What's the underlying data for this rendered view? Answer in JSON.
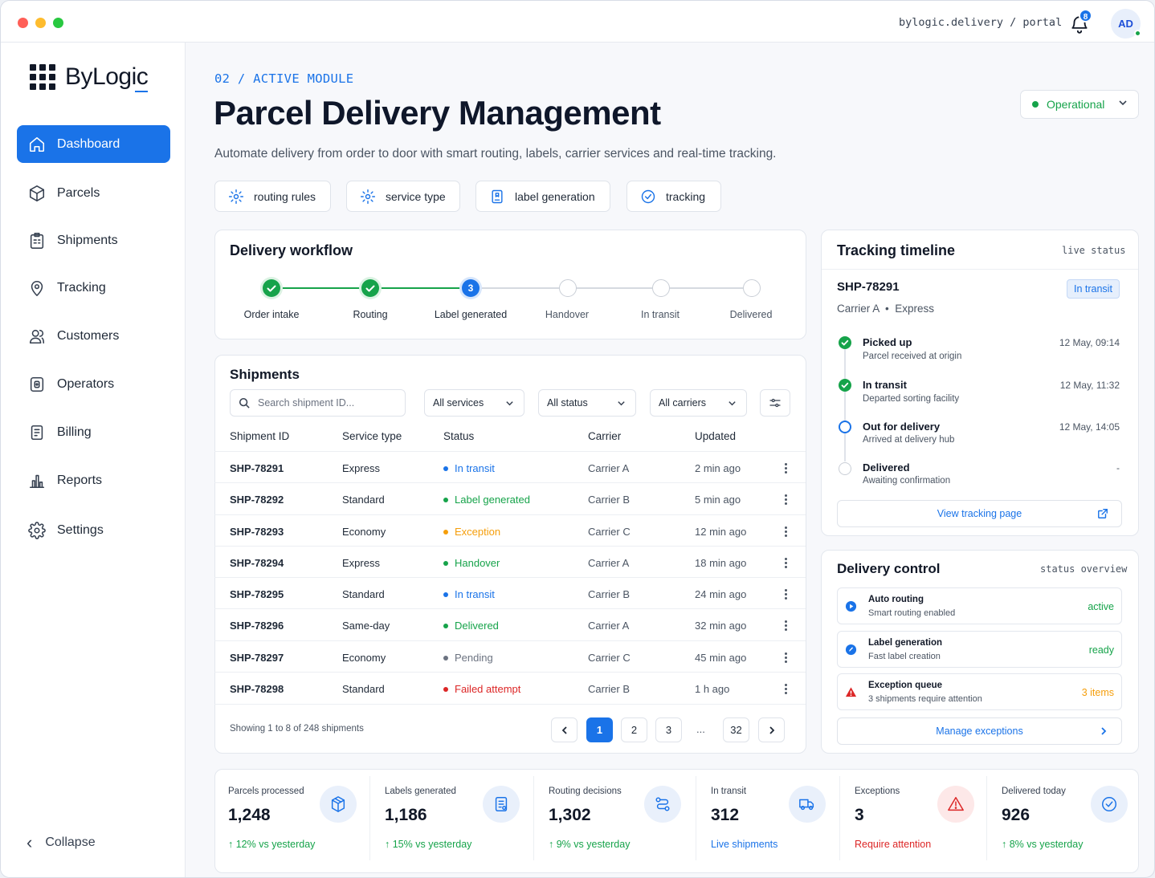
{
  "topbar": {
    "path": "bylogic.delivery / portal",
    "notification_count": "8",
    "avatar_initials": "AD"
  },
  "brand": {
    "name": "ByLogic",
    "accent": "#1a73e8"
  },
  "sidebar": {
    "items": [
      {
        "label": "Dashboard",
        "icon": "home-icon",
        "active": true
      },
      {
        "label": "Parcels",
        "icon": "box-icon"
      },
      {
        "label": "Shipments",
        "icon": "clipboard-icon"
      },
      {
        "label": "Tracking",
        "icon": "map-pin-icon"
      },
      {
        "label": "Customers",
        "icon": "users-icon"
      },
      {
        "label": "Operators",
        "icon": "id-badge-icon"
      },
      {
        "label": "Billing",
        "icon": "invoice-icon"
      },
      {
        "label": "Reports",
        "icon": "bar-chart-icon"
      },
      {
        "label": "Settings",
        "icon": "gear-icon"
      }
    ],
    "collapse_label": "Collapse"
  },
  "header": {
    "breadcrumb": "02 / ACTIVE MODULE",
    "title": "Parcel Delivery Management",
    "subtitle": "Automate delivery from order to door with smart routing, labels, carrier services and real-time tracking.",
    "status_select": "Operational"
  },
  "chips": [
    {
      "label": "routing rules",
      "icon": "gear-icon"
    },
    {
      "label": "service type",
      "icon": "gear-icon"
    },
    {
      "label": "label generation",
      "icon": "label-icon"
    },
    {
      "label": "tracking",
      "icon": "check-circle-icon"
    }
  ],
  "workflow": {
    "title": "Delivery workflow",
    "current_step_number": "3",
    "steps": [
      {
        "label": "Order intake",
        "state": "done"
      },
      {
        "label": "Routing",
        "state": "done"
      },
      {
        "label": "Label generated",
        "state": "current"
      },
      {
        "label": "Handover",
        "state": "pending"
      },
      {
        "label": "In transit",
        "state": "pending"
      },
      {
        "label": "Delivered",
        "state": "pending"
      }
    ]
  },
  "shipments": {
    "title": "Shipments",
    "search_placeholder": "Search shipment ID...",
    "filters": [
      "All services",
      "All status",
      "All carriers"
    ],
    "columns": [
      "Shipment ID",
      "Service type",
      "Status",
      "Carrier",
      "Updated"
    ],
    "rows": [
      {
        "id": "SHP-78291",
        "service": "Express",
        "status": "In transit",
        "status_color": "#1a73e8",
        "carrier": "Carrier A",
        "updated": "2 min ago"
      },
      {
        "id": "SHP-78292",
        "service": "Standard",
        "status": "Label generated",
        "status_color": "#16a34a",
        "carrier": "Carrier B",
        "updated": "5 min ago"
      },
      {
        "id": "SHP-78293",
        "service": "Economy",
        "status": "Exception",
        "status_color": "#f59e0b",
        "carrier": "Carrier C",
        "updated": "12 min ago"
      },
      {
        "id": "SHP-78294",
        "service": "Express",
        "status": "Handover",
        "status_color": "#16a34a",
        "carrier": "Carrier A",
        "updated": "18 min ago"
      },
      {
        "id": "SHP-78295",
        "service": "Standard",
        "status": "In transit",
        "status_color": "#1a73e8",
        "carrier": "Carrier B",
        "updated": "24 min ago"
      },
      {
        "id": "SHP-78296",
        "service": "Same-day",
        "status": "Delivered",
        "status_color": "#16a34a",
        "carrier": "Carrier A",
        "updated": "32 min ago"
      },
      {
        "id": "SHP-78297",
        "service": "Economy",
        "status": "Pending",
        "status_color": "#6b7280",
        "carrier": "Carrier C",
        "updated": "45 min ago"
      },
      {
        "id": "SHP-78298",
        "service": "Standard",
        "status": "Failed attempt",
        "status_color": "#dc2626",
        "carrier": "Carrier B",
        "updated": "1 h ago"
      }
    ],
    "footer_text": "Showing 1 to 8 of 248 shipments",
    "pages": [
      "1",
      "2",
      "3",
      "...",
      "32"
    ]
  },
  "tracking": {
    "title": "Tracking timeline",
    "tag": "live status",
    "shipment_id": "SHP-78291",
    "badge": "In transit",
    "carrier_line": "Carrier A  •  Express",
    "events": [
      {
        "title": "Picked up",
        "sub": "Parcel received at origin",
        "time": "12 May, 09:14",
        "state": "done"
      },
      {
        "title": "In transit",
        "sub": "Departed sorting facility",
        "time": "12 May, 11:32",
        "state": "done"
      },
      {
        "title": "Out for delivery",
        "sub": "Arrived at delivery hub",
        "time": "12 May, 14:05",
        "state": "current"
      },
      {
        "title": "Delivered",
        "sub": "Awaiting confirmation",
        "time": "-",
        "state": "pending"
      }
    ],
    "view_button": "View tracking page"
  },
  "delivery_control": {
    "title": "Delivery control",
    "tag": "status overview",
    "rows": [
      {
        "title": "Auto routing",
        "sub": "Smart routing enabled",
        "value": "active",
        "color": "#16a34a",
        "icon": "play-icon"
      },
      {
        "title": "Label generation",
        "sub": "Fast label creation",
        "value": "ready",
        "color": "#16a34a",
        "icon": "rocket-icon"
      },
      {
        "title": "Exception queue",
        "sub": "3 shipments require attention",
        "value": "3 items",
        "color": "#f59e0b",
        "icon": "warning-icon"
      }
    ],
    "manage_button": "Manage exceptions"
  },
  "stats": [
    {
      "label": "Parcels processed",
      "value": "1,248",
      "delta": "12% vs yesterday",
      "delta_color": "#16a34a",
      "icon": "cube-icon",
      "arrow": true
    },
    {
      "label": "Labels generated",
      "value": "1,186",
      "delta": "15% vs yesterday",
      "delta_color": "#16a34a",
      "icon": "document-icon",
      "arrow": true
    },
    {
      "label": "Routing decisions",
      "value": "1,302",
      "delta": "9% vs yesterday",
      "delta_color": "#16a34a",
      "icon": "route-icon",
      "arrow": true
    },
    {
      "label": "In transit",
      "value": "312",
      "delta": "Live shipments",
      "delta_color": "#1a73e8",
      "icon": "truck-icon",
      "arrow": false
    },
    {
      "label": "Exceptions",
      "value": "3",
      "delta": "Require attention",
      "delta_color": "#dc2626",
      "icon": "warning-icon",
      "arrow": false
    },
    {
      "label": "Delivered today",
      "value": "926",
      "delta": "8% vs yesterday",
      "delta_color": "#16a34a",
      "icon": "check-circle-icon",
      "arrow": true
    }
  ]
}
